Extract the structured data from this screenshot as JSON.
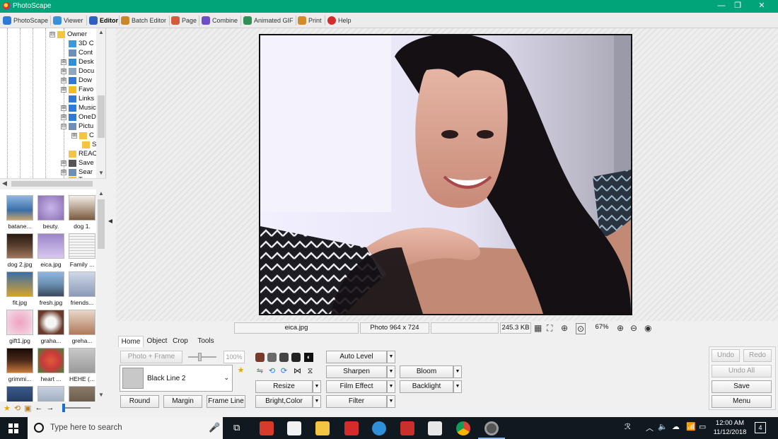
{
  "window": {
    "title": "PhotoScape",
    "controls": [
      "—",
      "❐",
      "✕"
    ]
  },
  "tabs": [
    {
      "label": "PhotoScape",
      "color": "#2f7ad6"
    },
    {
      "label": "Viewer",
      "color": "#3a8fd9"
    },
    {
      "label": "Editor",
      "color": "#2f5fbf"
    },
    {
      "label": "Batch Editor",
      "color": "#c9872b"
    },
    {
      "label": "Page",
      "color": "#d45a3a"
    },
    {
      "label": "Combine",
      "color": "#6d4fc7"
    },
    {
      "label": "Animated GIF",
      "color": "#2f8f55"
    },
    {
      "label": "Print",
      "color": "#d48a2b"
    },
    {
      "label": "Help",
      "color": "#d42b2b"
    }
  ],
  "active_tab": "Editor",
  "tree": {
    "items": [
      {
        "label": "Owner",
        "icon": "folder-icon",
        "color": "#f4c542",
        "expander": "⊟"
      },
      {
        "label": "3D C",
        "icon": "3d-objects-icon",
        "color": "#3b9ad9",
        "expander": ""
      },
      {
        "label": "Cont",
        "icon": "contacts-icon",
        "color": "#6e8fb5",
        "expander": ""
      },
      {
        "label": "Desk",
        "icon": "desktop-icon",
        "color": "#2f8fd9",
        "expander": "⊞"
      },
      {
        "label": "Docu",
        "icon": "documents-icon",
        "color": "#8fa6bf",
        "expander": "⊞"
      },
      {
        "label": "Dow",
        "icon": "downloads-icon",
        "color": "#2f7ad6",
        "expander": "⊞"
      },
      {
        "label": "Favo",
        "icon": "favorites-icon",
        "color": "#f0c020",
        "expander": "⊞"
      },
      {
        "label": "Links",
        "icon": "links-icon",
        "color": "#2f7ad6",
        "expander": ""
      },
      {
        "label": "Music",
        "icon": "music-icon",
        "color": "#2f7ad6",
        "expander": "⊞"
      },
      {
        "label": "OneD",
        "icon": "onedrive-icon",
        "color": "#2f7ad6",
        "expander": "⊞"
      },
      {
        "label": "Pictu",
        "icon": "pictures-icon",
        "color": "#6e8fb5",
        "expander": "⊟"
      },
      {
        "label": "C",
        "icon": "folder-icon",
        "color": "#f4c542",
        "expander": "⊞"
      },
      {
        "label": "S",
        "icon": "folder-icon",
        "color": "#f4c542",
        "expander": ""
      },
      {
        "label": "REAC",
        "icon": "folder-icon",
        "color": "#f4c542",
        "expander": ""
      },
      {
        "label": "Save",
        "icon": "saved-games-icon",
        "color": "#555555",
        "expander": "⊞"
      },
      {
        "label": "Sear",
        "icon": "search-icon",
        "color": "#6e8fb5",
        "expander": "⊞"
      },
      {
        "label": "T",
        "icon": "folder-icon",
        "color": "#f4c542",
        "expander": ""
      }
    ]
  },
  "thumbnails": [
    {
      "caption": "batane...",
      "color": "#3a6ea8"
    },
    {
      "caption": "beuty.",
      "color": "#8c6fb5"
    },
    {
      "caption": "dog 1.",
      "color": "#7a5a3d"
    },
    {
      "caption": "dog 2.jpg",
      "color": "#5a4030"
    },
    {
      "caption": "eica.jpg",
      "color": "#9a86c8"
    },
    {
      "caption": "Family ...",
      "color": "#d6d6d6"
    },
    {
      "caption": "fit.jpg",
      "color": "#d6a22b"
    },
    {
      "caption": "fresh.jpg",
      "color": "#6a8fb0"
    },
    {
      "caption": "friends...",
      "color": "#8a9ab8"
    },
    {
      "caption": "gift1.jpg",
      "color": "#f0e0e8"
    },
    {
      "caption": "graha...",
      "color": "#6a3a2a"
    },
    {
      "caption": "greha...",
      "color": "#b07a5a"
    },
    {
      "caption": "grimmi...",
      "color": "#4a2a1a"
    },
    {
      "caption": "heart ...",
      "color": "#c83a3a"
    },
    {
      "caption": "HEHE (...",
      "color": "#9a9a9a"
    },
    {
      "caption": "",
      "color": "#3a5a8a"
    },
    {
      "caption": "",
      "color": "#8a9ab0"
    },
    {
      "caption": "",
      "color": "#5a4a3a"
    }
  ],
  "statusbar": {
    "filename": "eica.jpg",
    "dimensions": "Photo 964 x 724",
    "filesize": "245.3 KB",
    "zoom": "67%"
  },
  "subtabs": [
    "Home",
    "Object",
    "Crop",
    "Tools"
  ],
  "active_subtab": "Home",
  "home": {
    "photo_frame": "Photo + Frame",
    "opacity": "100%",
    "frame_name": "Black Line 2",
    "round": "Round",
    "margin": "Margin",
    "frame_line": "Frame Line",
    "resize": "Resize",
    "bright_color": "Bright,Color",
    "auto_level": "Auto Level",
    "sharpen": "Sharpen",
    "film_effect": "Film Effect",
    "filter": "Filter",
    "bloom": "Bloom",
    "backlight": "Backlight",
    "undo": "Undo",
    "redo": "Redo",
    "undo_all": "Undo All",
    "save": "Save",
    "menu": "Menu"
  },
  "taskbar": {
    "search_placeholder": "Type here to search",
    "time": "12:00 AM",
    "date": "11/12/2018",
    "notifications": "4",
    "apps": [
      {
        "name": "task-view-icon",
        "color": "#101820"
      },
      {
        "name": "office-icon",
        "color": "#d83b2b"
      },
      {
        "name": "store-icon",
        "color": "#f2f2f2"
      },
      {
        "name": "file-explorer-icon",
        "color": "#f4c542"
      },
      {
        "name": "lego-icon",
        "color": "#d42b2b"
      },
      {
        "name": "edge-icon",
        "color": "#2f8fd9"
      },
      {
        "name": "acrobat-icon",
        "color": "#c9302b"
      },
      {
        "name": "mail-icon",
        "color": "#e8e8e8"
      },
      {
        "name": "chrome-icon",
        "color": "#4caf50"
      },
      {
        "name": "photoscape-icon",
        "color": "#9a9a9a"
      }
    ]
  },
  "colors": {
    "titlebar": "#00a478",
    "taskbar": "#101820"
  }
}
